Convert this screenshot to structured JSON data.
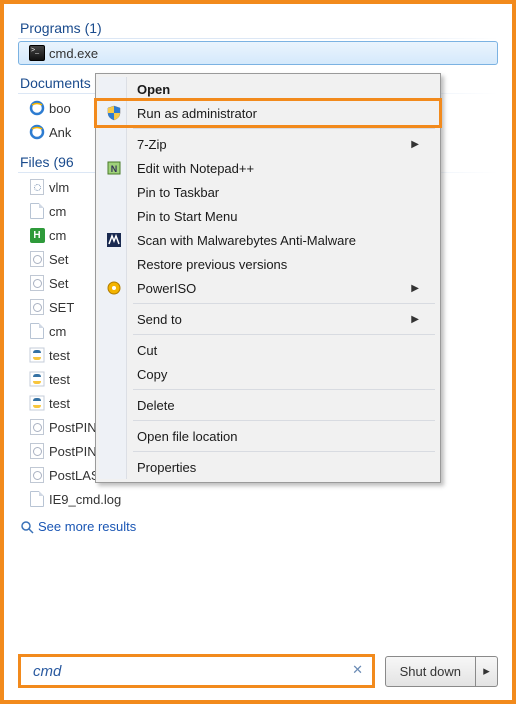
{
  "sections": {
    "programs": {
      "header": "Programs (1)",
      "items": [
        {
          "label": "cmd.exe",
          "icon": "cmd"
        }
      ]
    },
    "documents": {
      "header": "Documents",
      "items": [
        {
          "label": "boo",
          "icon": "ie"
        },
        {
          "label": "Ank",
          "icon": "ie"
        }
      ]
    },
    "files": {
      "header": "Files (96",
      "items": [
        {
          "label": "vlm",
          "icon": "inf"
        },
        {
          "label": "cm",
          "icon": "file"
        },
        {
          "label": "cm",
          "icon": "h"
        },
        {
          "label": "Set",
          "icon": "bat"
        },
        {
          "label": "Set",
          "icon": "bat"
        },
        {
          "label": "SET",
          "icon": "bat"
        },
        {
          "label": "cm",
          "icon": "file"
        },
        {
          "label": "test",
          "icon": "py"
        },
        {
          "label": "test",
          "icon": "py"
        },
        {
          "label": "test",
          "icon": "py"
        },
        {
          "label": "PostPININST.CMD",
          "icon": "bat"
        },
        {
          "label": "PostPININST_BBV.CMD",
          "icon": "bat"
        },
        {
          "label": "PostLAST.cmd",
          "icon": "bat"
        },
        {
          "label": "IE9_cmd.log",
          "icon": "file"
        }
      ]
    }
  },
  "see_more": "See more results",
  "search": {
    "value": "cmd",
    "clear_glyph": "✕"
  },
  "shutdown": {
    "label": "Shut down",
    "arrow": "▸"
  },
  "context_menu": {
    "items": [
      {
        "label": "Open",
        "bold": true
      },
      {
        "label": "Run as administrator",
        "icon": "shield",
        "highlight": true
      },
      {
        "sep": true
      },
      {
        "label": "7-Zip",
        "submenu": true
      },
      {
        "label": "Edit with Notepad++",
        "icon": "npp"
      },
      {
        "label": "Pin to Taskbar"
      },
      {
        "label": "Pin to Start Menu"
      },
      {
        "label": "Scan with Malwarebytes Anti-Malware",
        "icon": "mbam"
      },
      {
        "label": "Restore previous versions"
      },
      {
        "label": "PowerISO",
        "icon": "poweriso",
        "submenu": true
      },
      {
        "sep": true
      },
      {
        "label": "Send to",
        "submenu": true
      },
      {
        "sep": true
      },
      {
        "label": "Cut"
      },
      {
        "label": "Copy"
      },
      {
        "sep": true
      },
      {
        "label": "Delete"
      },
      {
        "sep": true
      },
      {
        "label": "Open file location"
      },
      {
        "sep": true
      },
      {
        "label": "Properties"
      }
    ]
  }
}
